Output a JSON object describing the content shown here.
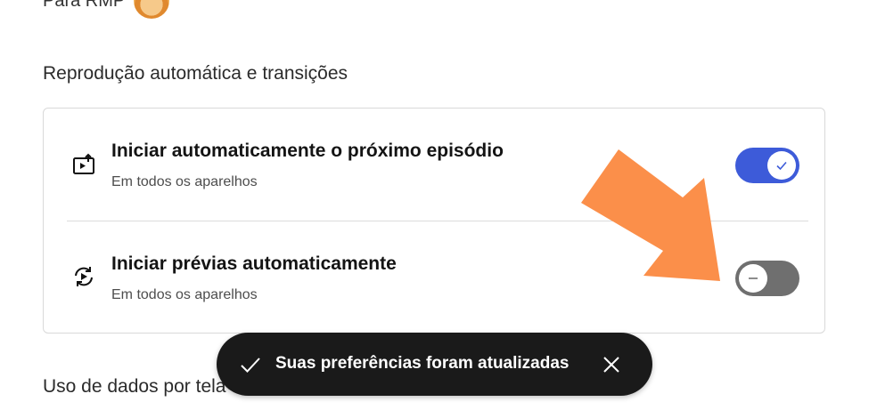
{
  "profile": {
    "label": "Para RMP"
  },
  "autoplay_section": {
    "title": "Reprodução automática e transições",
    "items": [
      {
        "title": "Iniciar automaticamente o próximo episódio",
        "subtitle": "Em todos os aparelhos",
        "enabled": true,
        "icon": "next-episode-icon"
      },
      {
        "title": "Iniciar prévias automaticamente",
        "subtitle": "Em todos os aparelhos",
        "enabled": false,
        "icon": "autoplay-previews-icon"
      }
    ]
  },
  "data_section": {
    "title": "Uso de dados por tela"
  },
  "toast": {
    "message": "Suas preferências foram atualizadas",
    "icon": "check-icon",
    "close_icon": "close-icon"
  },
  "colors": {
    "toggle_on": "#3d5bd9",
    "toggle_off": "#6f6f6f",
    "annotation_arrow": "#fb8f4a",
    "toast_bg": "#1a1a1a"
  }
}
